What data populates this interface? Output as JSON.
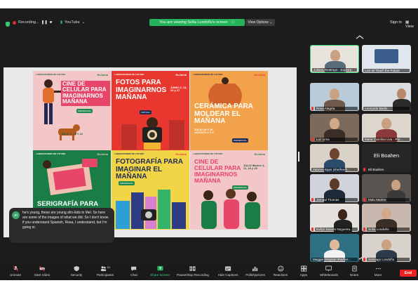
{
  "topbar": {
    "recording": "Recording...",
    "source": "YouTube",
    "viewing_banner": "You are viewing Sofia Londoño's screen",
    "view_options": "View Options",
    "sign_in": "Sign in",
    "view": "View"
  },
  "shared_screen": {
    "posters": [
      {
        "title": "Cine de celular para imaginarnos mañana",
        "dates": "JULIO 1, 15 Y 22",
        "tag": "PRESENCIAL",
        "lab": "LABORATORIOS DE FUTURO",
        "brand": "EnJoink"
      },
      {
        "title": "Fotos para imaginarnos mañana",
        "dates": "JUNIO 6, 13, 20 y 27",
        "tag": "VIRTUAL",
        "lab": "LABORATORIOS DE FUTURO",
        "brand": "EnJoink"
      },
      {
        "title": "Cerámica para moldear el mañana",
        "dates": "JULIO 19 Y 26 AGOSTO 2 Y 9",
        "tag": "PRESENCIAL",
        "lab": "LABORATORIOS DE FUTURO",
        "brand": "EnJoink"
      },
      {
        "title": "Serigrafía para imaginar el mañana",
        "dates": "",
        "tag": "",
        "lab": "LABORATORIOS DE FUTURO",
        "brand": "EnJoink"
      },
      {
        "title": "Fotografía para imaginar el mañana",
        "dates": "",
        "tag": "PRESENCIAL",
        "lab": "LABORATORIOS DE FUTURO",
        "brand": "EnJoink"
      },
      {
        "title": "Cine de celular para imaginarnos mañana",
        "dates": "JULIO Martes 4, 11, 18 y 25",
        "tag": "PRESENCIAL",
        "lab": "LABORATORIOS DE FUTURO",
        "brand": "EnJoink"
      }
    ]
  },
  "gallery": [
    {
      "name": "Juliana Restrepo - Explora",
      "bg": "#e8e3dc",
      "active": true
    },
    {
      "name": "Live w/ Teach the Future",
      "bg": "#dfe6ee",
      "active": false
    },
    {
      "name": "Rosa Alegría",
      "bg": "#b9cbd9",
      "active": false
    },
    {
      "name": "Leonardo Bedin",
      "bg": "#d9dde2",
      "active": false
    },
    {
      "name": "Luz Lima",
      "bg": "#7c6a5c",
      "active": false
    },
    {
      "name": "Maria Carolina Uva - Por...",
      "bg": "#ddd6cc",
      "active": false
    },
    {
      "name": "Zabrina Epps (she/her/h...",
      "bg": "#d9d2c6",
      "active": false
    },
    {
      "name": "Eli Boahen",
      "bg": "#262626",
      "active": false,
      "big_name": "Eli Boahen"
    },
    {
      "name": "Jamaal Thomas",
      "bg": "#cfd4da",
      "active": false
    },
    {
      "name": "Malu Martire",
      "bg": "#5b5552",
      "active": false
    },
    {
      "name": "Evilyn Soares Nogueira...",
      "bg": "#e5e2de",
      "active": false
    },
    {
      "name": "Sofia Londoño",
      "bg": "#c8b8ae",
      "active": false
    },
    {
      "name": "Maggie Greyson she/her...",
      "bg": "#2f6f83",
      "active": false
    },
    {
      "name": "Santiago Londoño",
      "bg": "#d7d2cb",
      "active": false
    }
  ],
  "chat": {
    "initials": "JR",
    "text": "he's young, these are young afro kids in Mel. So here are some of the images of what we did. So I don't know if you understand Spanish, Rosa, I understand, but I'm going to"
  },
  "toolbar": {
    "unmute": "Unmute",
    "start_video": "Start Video",
    "security": "Security",
    "participants": "Participants",
    "participants_count": "61",
    "chat": "Chat",
    "share_screen": "Share Screen",
    "record": "Pause/Stop Recording",
    "captions": "Hide Captions",
    "polls": "Polls/Quizzes",
    "reactions": "Reactions",
    "apps": "Apps",
    "whiteboards": "Whiteboards",
    "notes": "Notes",
    "more": "More",
    "end": "End"
  },
  "colors": {
    "accent_green": "#24b35a",
    "end_red": "#e22222",
    "toolbar_bg": "#1a1a1a"
  }
}
